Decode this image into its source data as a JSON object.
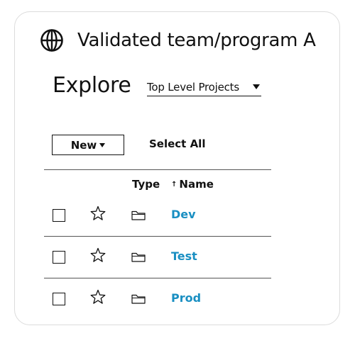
{
  "header": {
    "title": "Validated team/program A"
  },
  "explore": {
    "label": "Explore",
    "dropdown_value": "Top Level Projects"
  },
  "toolbar": {
    "new_label": "New",
    "select_all_label": "Select All"
  },
  "table": {
    "columns": {
      "type": "Type",
      "name": "Name",
      "sort_indicator": "↑"
    },
    "rows": [
      {
        "name": "Dev",
        "type_icon": "folder-icon",
        "starred": false,
        "checked": false
      },
      {
        "name": "Test",
        "type_icon": "folder-icon",
        "starred": false,
        "checked": false
      },
      {
        "name": "Prod",
        "type_icon": "folder-icon",
        "starred": false,
        "checked": false
      }
    ]
  },
  "colors": {
    "link": "#1a8fc2",
    "text": "#111111",
    "divider": "#555555",
    "card_border": "#dcdcdc"
  }
}
